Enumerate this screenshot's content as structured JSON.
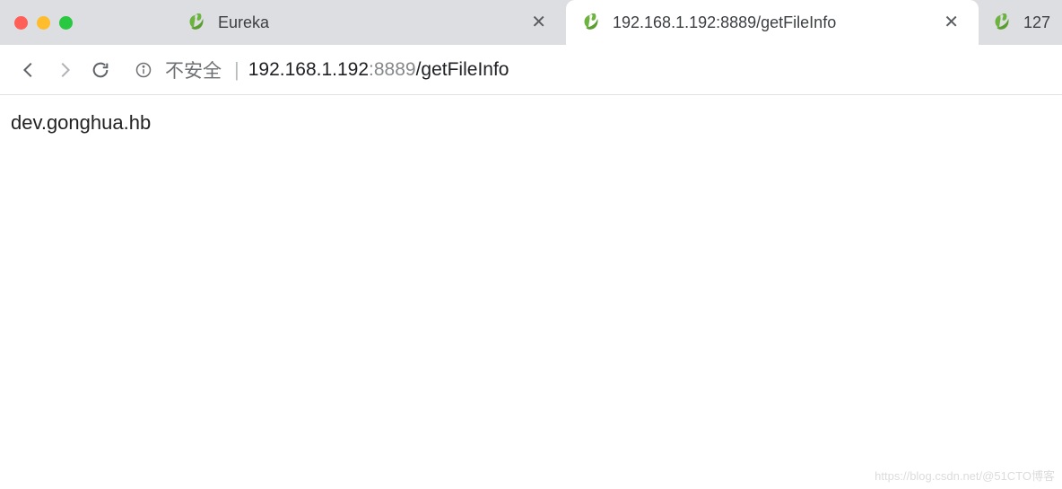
{
  "tabs": {
    "t0": {
      "title": "Eureka"
    },
    "t1": {
      "title": "192.168.1.192:8889/getFileInfo"
    },
    "t2": {
      "title": "127"
    }
  },
  "addr": {
    "security_label": "不安全",
    "host": "192.168.1.192",
    "port": ":8889",
    "path": "/getFileInfo"
  },
  "page": {
    "body_text": "dev.gonghua.hb"
  },
  "watermark": "https://blog.csdn.net/@51CTO博客"
}
